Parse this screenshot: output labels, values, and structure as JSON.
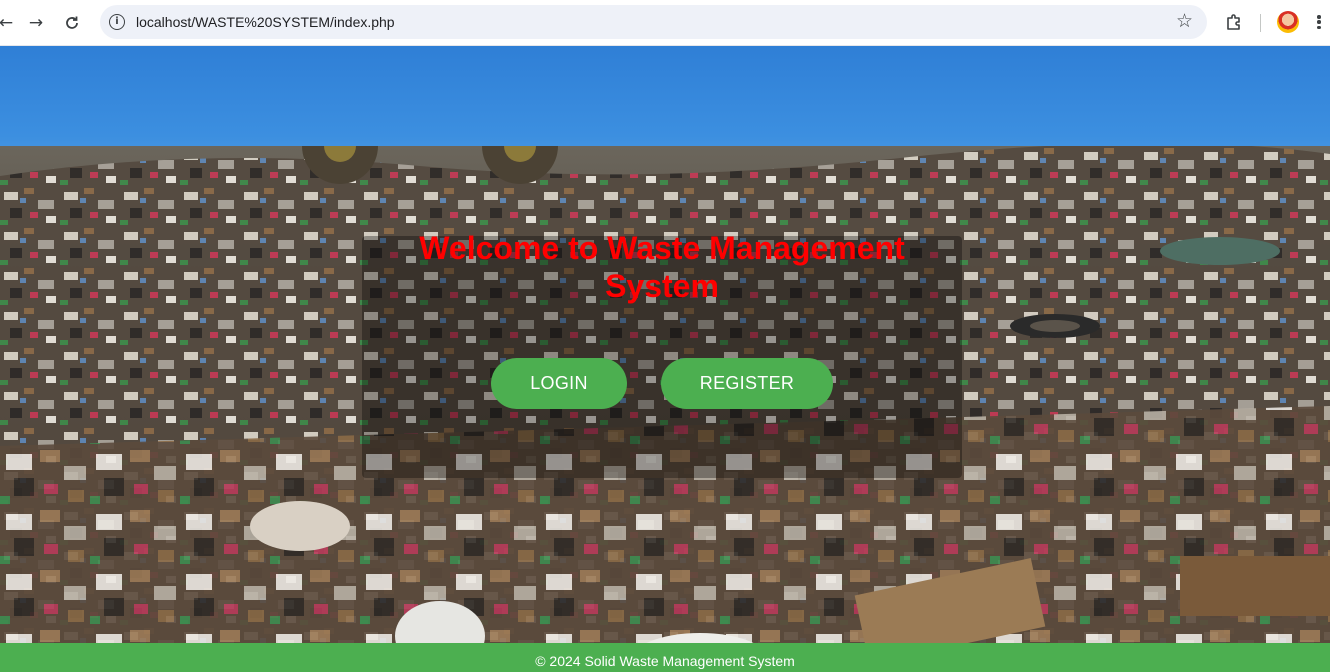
{
  "browser": {
    "url": "localhost/WASTE%20SYSTEM/index.php",
    "icons": {
      "back": "arrow-left-icon",
      "forward": "arrow-right-icon",
      "reload": "reload-icon",
      "info": "info-icon",
      "bookmark": "star-icon",
      "extensions": "puzzle-icon",
      "menu": "kebab-menu-icon"
    }
  },
  "hero": {
    "title": "Welcome to Waste Management System",
    "background": "landfill photo with bulldozer under blue sky"
  },
  "actions": {
    "login_label": "LOGIN",
    "register_label": "REGISTER"
  },
  "footer": {
    "text": "© 2024 Solid Waste Management System"
  },
  "colors": {
    "title": "#ff0000",
    "button": "#4caf50",
    "footer": "#4caf50",
    "overlay": "rgba(0,0,0,0.32)"
  }
}
